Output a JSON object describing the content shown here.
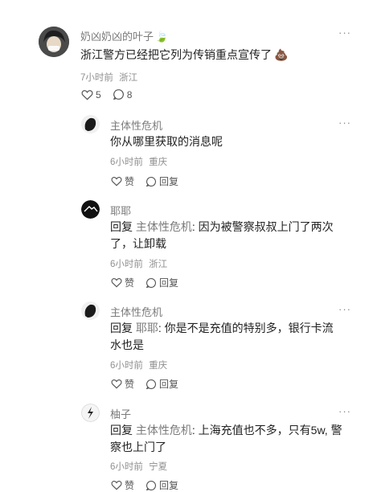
{
  "comment": {
    "author": "奶凶奶凶的叶子",
    "author_emoji": "🍃",
    "text": "浙江警方已经把它列为传销重点宣传了",
    "text_emoji": "💩",
    "time": "7小时前",
    "location": "浙江",
    "likes": "5",
    "replies_count": "8"
  },
  "more_label": "···",
  "like_label": "赞",
  "reply_label": "回复",
  "reply_prefix": "回复",
  "replies": [
    {
      "author": "主体性危机",
      "reply_to": "",
      "text": "你从哪里获取的消息呢",
      "time": "6小时前",
      "location": "重庆"
    },
    {
      "author": "耶耶",
      "reply_to": "主体性危机",
      "text": "因为被警察叔叔上门了两次了，让卸载",
      "time": "6小时前",
      "location": "浙江"
    },
    {
      "author": "主体性危机",
      "reply_to": "耶耶",
      "text": "你是不是充值的特别多，银行卡流水也是",
      "time": "6小时前",
      "location": "重庆"
    },
    {
      "author": "柚子",
      "reply_to": "主体性危机",
      "text": "上海充值也不多，只有5w, 警察也上门了",
      "time": "6小时前",
      "location": "宁夏"
    }
  ]
}
